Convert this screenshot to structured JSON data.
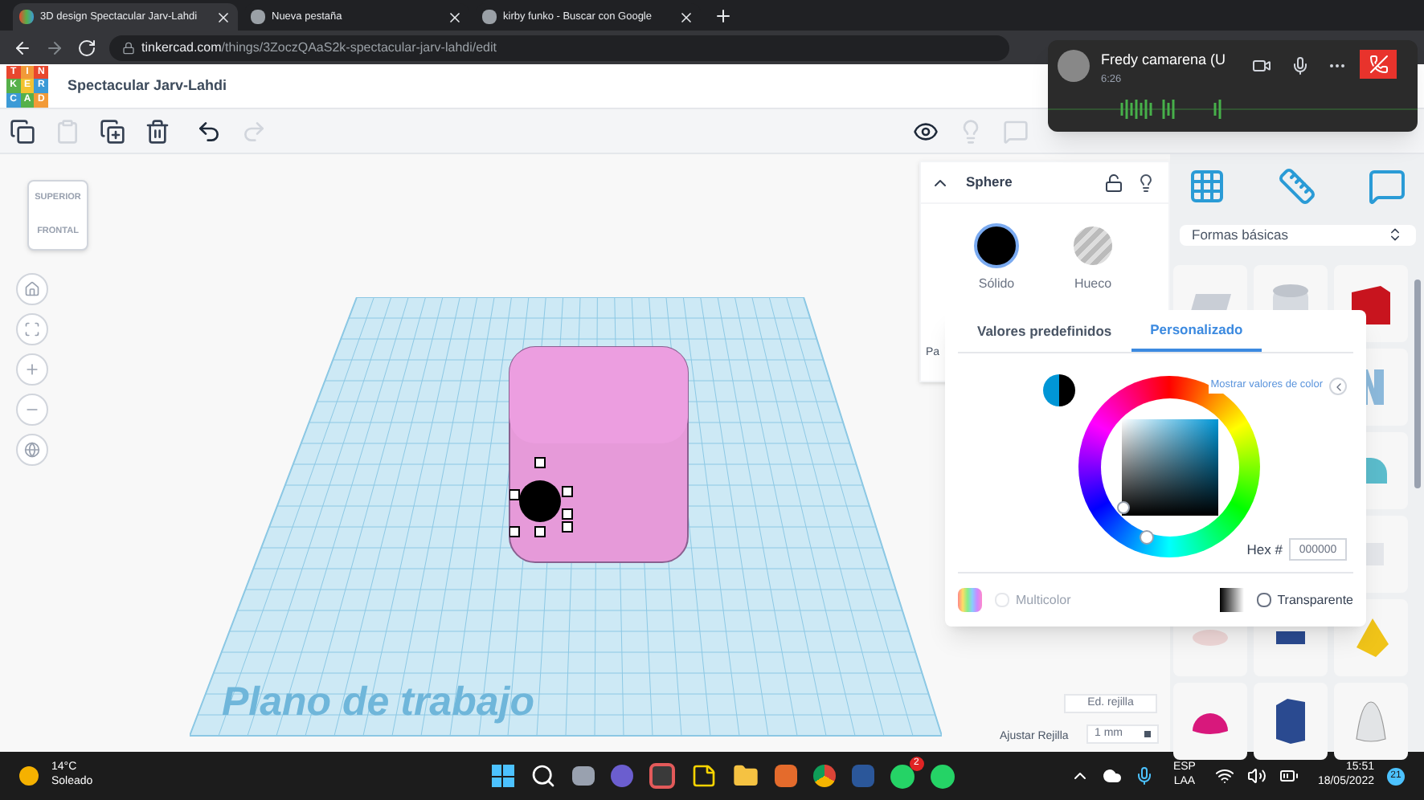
{
  "browser": {
    "tabs": [
      {
        "title": "3D design Spectacular Jarv-Lahdi",
        "selected": true
      },
      {
        "title": "Nueva pestaña",
        "selected": false
      },
      {
        "title": "kirby funko - Buscar con Google",
        "selected": false
      }
    ],
    "url_domain": "tinkercad.com",
    "url_path": "/things/3ZoczQAaS2k-spectacular-jarv-lahdi/edit"
  },
  "app": {
    "logo_letters": [
      "T",
      "I",
      "N",
      "K",
      "E",
      "R",
      "C",
      "A",
      "D"
    ],
    "design_title": "Spectacular Jarv-Lahdi"
  },
  "view_cube": {
    "top": "SUPERIOR",
    "front": "FRONTAL"
  },
  "workplane": {
    "label": "Plano de trabajo"
  },
  "inspector": {
    "title": "Sphere",
    "locked": false,
    "modes": [
      {
        "label": "Sólido",
        "kind": "solid",
        "selected": true
      },
      {
        "label": "Hueco",
        "kind": "hole",
        "selected": false
      }
    ],
    "cut_label": "Pa"
  },
  "color_picker": {
    "tabs": [
      {
        "label": "Valores predefinidos",
        "selected": false
      },
      {
        "label": "Personalizado",
        "selected": true
      }
    ],
    "show_values_link": "Mostrar valores de color",
    "hex_label": "Hex #",
    "hex_value": "000000",
    "multicolor": {
      "label": "Multicolor",
      "checked": false,
      "disabled": true
    },
    "transparent": {
      "label": "Transparente",
      "checked": false
    }
  },
  "shapes": {
    "category": "Formas básicas"
  },
  "grid": {
    "edit_button": "Ed. rejilla",
    "snap_label": "Ajustar Rejilla",
    "snap_value": "1 mm"
  },
  "call": {
    "name": "Fredy camarena (U",
    "duration": "6:26"
  },
  "taskbar": {
    "weather_temp": "14°C",
    "weather_text": "Soleado",
    "whatsapp_badge": "2",
    "language": "ESP",
    "layout": "LAA",
    "time": "15:51",
    "date": "18/05/2022",
    "notification_count": "21"
  }
}
